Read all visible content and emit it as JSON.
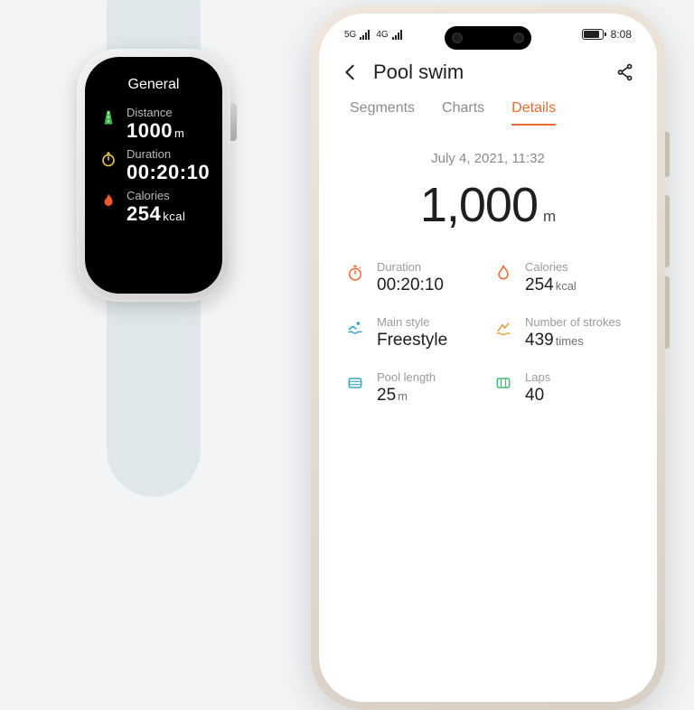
{
  "watch": {
    "title": "General",
    "metrics": [
      {
        "icon": "road-icon",
        "label": "Distance",
        "value": "1000",
        "unit": "m"
      },
      {
        "icon": "stopwatch-icon",
        "label": "Duration",
        "value": "00:20:10",
        "unit": ""
      },
      {
        "icon": "flame-icon",
        "label": "Calories",
        "value": "254",
        "unit": "kcal"
      }
    ]
  },
  "phone": {
    "status": {
      "net1": "5G",
      "net2": "4G",
      "time": "8:08"
    },
    "header": {
      "title": "Pool swim"
    },
    "tabs": [
      {
        "label": "Segments",
        "active": false
      },
      {
        "label": "Charts",
        "active": false
      },
      {
        "label": "Details",
        "active": true
      }
    ],
    "datetime": "July 4, 2021, 11:32",
    "hero": {
      "value": "1,000",
      "unit": "m"
    },
    "stats": [
      {
        "icon": "stopwatch-icon",
        "color": "#ed6a2f",
        "label": "Duration",
        "value": "00:20:10",
        "unit": ""
      },
      {
        "icon": "flame-icon",
        "color": "#ed6a2f",
        "label": "Calories",
        "value": "254",
        "unit": "kcal"
      },
      {
        "icon": "swimmer-icon",
        "color": "#3aa6c8",
        "label": "Main style",
        "value": "Freestyle",
        "unit": ""
      },
      {
        "icon": "strokes-icon",
        "color": "#e2a33a",
        "label": "Number of strokes",
        "value": "439",
        "unit": "times"
      },
      {
        "icon": "pool-icon",
        "color": "#3aa6c8",
        "label": "Pool length",
        "value": "25",
        "unit": "m"
      },
      {
        "icon": "laps-icon",
        "color": "#46b871",
        "label": "Laps",
        "value": "40",
        "unit": ""
      }
    ]
  }
}
